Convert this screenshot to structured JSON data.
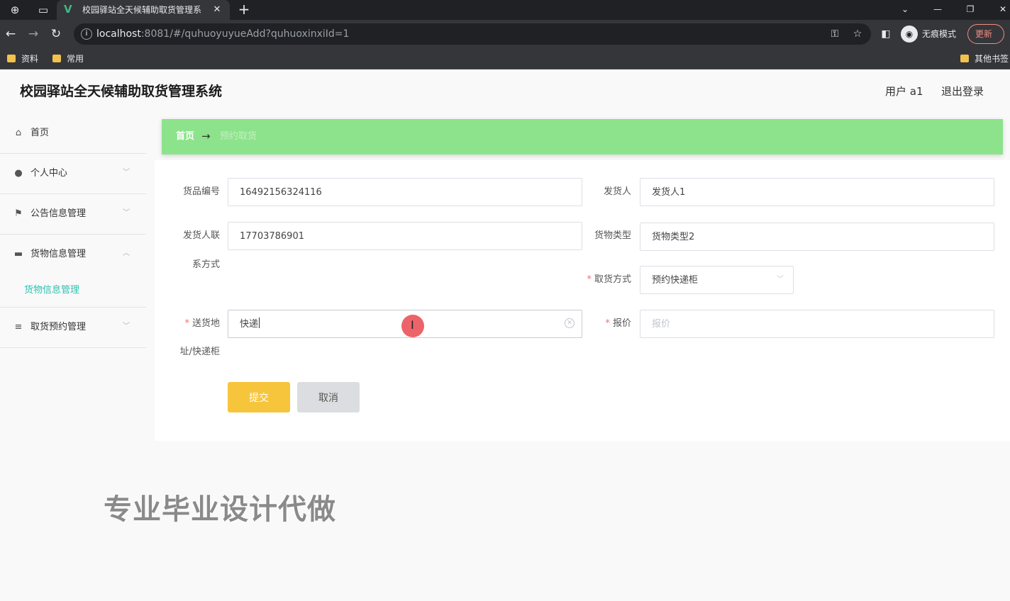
{
  "browser": {
    "tab_title": "校园驿站全天候辅助取货管理系",
    "url_host": "localhost",
    "url_rest": ":8081/#/quhuoyuyueAdd?quhuoxinxiId=1",
    "incognito_label": "无痕模式",
    "update_label": "更新",
    "bookmarks": [
      "资料",
      "常用"
    ],
    "other_bookmarks": "其他书签"
  },
  "app": {
    "title": "校园驿站全天候辅助取货管理系统",
    "user_label": "用户 a1",
    "logout_label": "退出登录"
  },
  "sidebar": {
    "items": [
      {
        "label": "首页",
        "icon": "home-icon"
      },
      {
        "label": "个人中心",
        "icon": "user-icon"
      },
      {
        "label": "公告信息管理",
        "icon": "flag-icon"
      },
      {
        "label": "货物信息管理",
        "icon": "ticket-icon"
      },
      {
        "label": "取货预约管理",
        "icon": "list-icon"
      }
    ],
    "submenu_active": "货物信息管理"
  },
  "breadcrumb": {
    "home": "首页",
    "arrow": "→",
    "current": "预约取货"
  },
  "form": {
    "huopin_bianhao": {
      "label": "货品编号",
      "value": "16492156324116"
    },
    "fahuoren": {
      "label": "发货人",
      "value": "发货人1"
    },
    "fahuoren_lianxi": {
      "label_line1": "发货人联",
      "label_line2": "系方式",
      "value": "17703786901"
    },
    "huowu_leixing": {
      "label": "货物类型",
      "value": "货物类型2"
    },
    "quhuo_fangshi": {
      "required": "*",
      "label": "取货方式",
      "value": "预约快递柜"
    },
    "songhuo_dizhi": {
      "required": "*",
      "label_line1": "送货地",
      "label_line2": "址/快递柜",
      "value": "快递"
    },
    "baojia": {
      "required": "*",
      "label": "报价",
      "placeholder": "报价"
    },
    "submit_label": "提交",
    "cancel_label": "取消"
  },
  "watermark": "专业毕业设计代做",
  "colors": {
    "breadcrumb_bg": "#8de38b",
    "submit_bg": "#f7c53c",
    "cancel_bg": "#dcdde0",
    "submenu_active": "#2fc1ae",
    "required_star": "#f56c6c"
  }
}
